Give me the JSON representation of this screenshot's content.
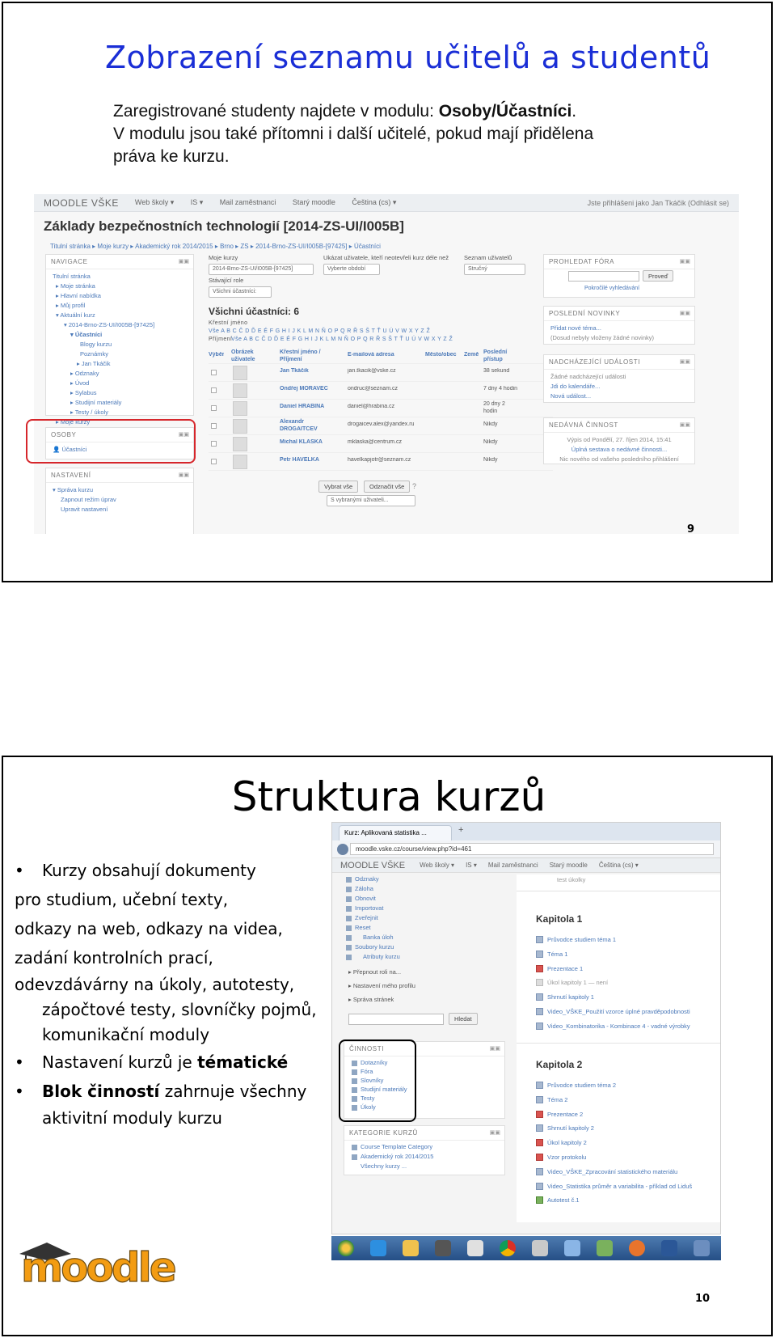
{
  "slide1": {
    "title": "Zobrazení seznamu učitelů a studentů",
    "intro_line1_pre": "Zaregistrované studenty najdete v modulu: ",
    "intro_line1_bold": "Osoby/Účastníci",
    "intro_line1_post": ".",
    "intro_line2": "V modulu jsou také přítomni i další učitelé, pokud mají přidělena",
    "intro_line3": "práva ke kurzu.",
    "page_number": "9",
    "screenshot": {
      "brand": "MOODLE VŠKE",
      "menu": [
        "Web školy ▾",
        "IS ▾",
        "Mail zaměstnanci",
        "Starý moodle",
        "Čeština (cs) ▾"
      ],
      "login": "Jste přihlášeni jako Jan Tkáčik (Odhlásit se)",
      "course_title": "Základy bezpečnostních technologií [2014-ZS-UI/I005B]",
      "breadcrumb": "Titulní stránka  ▸  Moje kurzy  ▸  Akademický rok 2014/2015  ▸  Brno  ▸  ZS  ▸  2014-Brno-ZS-UI/I005B-[97425]  ▸  Účastníci",
      "nav_block": {
        "title": "NAVIGACE",
        "items": [
          "Titulní stránka",
          "▸ Moje stránka",
          "▸ Hlavní nabídka",
          "▸ Můj profil",
          "▾ Aktuální kurz",
          "▾ 2014-Brno-ZS-UI/I005B-[97425]",
          "▾ Účastníci",
          "Blogy kurzu",
          "Poznámky",
          "▸ Jan Tkáčik",
          "▸ Odznaky",
          "▸ Úvod",
          "▸ Sylabus",
          "▸ Studijní materiály",
          "▸ Testy / úkoly",
          "▸ Moje kurzy"
        ]
      },
      "osoby_block": {
        "title": "OSOBY",
        "item": "Účastníci"
      },
      "settings_block": {
        "title": "NASTAVENÍ",
        "items": [
          "▾ Správa kurzu",
          "Zapnout režim úprav",
          "Upravit nastavení"
        ]
      },
      "filters": {
        "my_courses_label": "Moje kurzy",
        "my_courses_value": "2014-Brno-ZS-UI/I005B-[97425]",
        "show_users_label": "Ukázat uživatele, kteří neotevřeli kurz déle než",
        "show_users_value": "Vyberte období",
        "list_label": "Seznam uživatelů",
        "list_value": "Stručný",
        "role_label": "Stávající role",
        "role_value": "Všichni účastníci:"
      },
      "participants_heading": "Všichni účastníci: 6",
      "first_name_label": "Křestní jméno",
      "first_name_letters": "Vše  A B C Č D Ď E É F G H I J K L M N Ň O P Q R Ř S Š T Ť U Ú V W X Y Z Ž",
      "last_name_label": "Příjmení",
      "last_name_letters": "Vše  A B C Č D Ď E É F G H I J K L M N Ň O P Q R Ř S Š T Ť U Ú V W X Y Z Ž",
      "table_headers": [
        "Výběr",
        "Obrázek uživatele",
        "Křestní jméno / Příjmení",
        "E-mailová adresa",
        "Město/obec",
        "Země",
        "Poslední přístup"
      ],
      "rows": [
        {
          "name": "Jan Tkáčik",
          "email": "jan.tkacik@vske.cz",
          "last": "38 sekund"
        },
        {
          "name": "Ondřej MORAVEC",
          "email": "ondruc@seznam.cz",
          "last": "7 dny 4 hodin"
        },
        {
          "name": "Daniel HRABINA",
          "email": "daniel@hrabina.cz",
          "last": "20 dny 2 hodin"
        },
        {
          "name": "Alexandr DROGAITCEV",
          "email": "drogaicev.alex@yandex.ru",
          "last": "Nikdy"
        },
        {
          "name": "Michal KLAŠKA",
          "email": "mklaska@centrum.cz",
          "last": "Nikdy"
        },
        {
          "name": "Petr HAVELKA",
          "email": "havelkapjotr@seznam.cz",
          "last": "Nikdy"
        }
      ],
      "btn_select_all": "Vybrat vše",
      "btn_deselect_all": "Odznačit vše",
      "with_selected": "S vybranými uživateli...",
      "search_block": {
        "title": "PROHLEDAT FÓRA",
        "button": "Proveď",
        "advanced": "Pokročilé vyhledávání"
      },
      "news_block": {
        "title": "POSLEDNÍ NOVINKY",
        "item1": "Přidat nové téma...",
        "item2": "(Dosud nebyly vloženy žádné novinky)"
      },
      "events_block": {
        "title": "NADCHÁZEJÍCÍ UDÁLOSTI",
        "item1": "Žádné nadcházející události",
        "item2": "Jdi do kalendáře...",
        "item3": "Nová událost..."
      },
      "activity_block": {
        "title": "NEDÁVNÁ ČINNOST",
        "item1": "Výpis od Pondělí, 27. říjen 2014, 15:41",
        "item2": "Úplná sestava o nedávné činnosti...",
        "item3": "Nic nového od vašeho posledního přihlášení"
      }
    }
  },
  "slide2": {
    "title": "Struktura kurzů",
    "bullet1_lines": [
      "Kurzy obsahují dokumenty",
      "pro studium, učební texty,",
      "odkazy na web, odkazy na videa,",
      "zadání kontrolních prací,",
      "odevzdávárny na úkoly, autotesty,",
      "zápočtové testy, slovníčky pojmů,",
      "komunikační moduly"
    ],
    "bullet2_pre": "Nastavení kurzů je ",
    "bullet2_bold": "tématické",
    "bullet3_bold": "Blok činností",
    "bullet3_post": " zahrnuje všechny",
    "bullet3_line2": "aktivitní moduly kurzu",
    "page_number": "10",
    "logo_text": "moodle",
    "screenshot": {
      "tab": "Kurz: Aplikovaná statistika ...",
      "url": "moodle.vske.cz/course/view.php?id=461",
      "brand": "MOODLE VŠKE",
      "menu": [
        "Web školy ▾",
        "IS ▾",
        "Mail zaměstnanci",
        "Starý moodle",
        "Čeština (cs) ▾"
      ],
      "admin_items": [
        "Odznaky",
        "Záloha",
        "Obnovit",
        "Importovat",
        "Zveřejnit",
        "Reset",
        "Banka úloh",
        "Soubory kurzu",
        "Atributy kurzu"
      ],
      "admin_other": [
        "▸ Přepnout roli na...",
        "▸ Nastavení mého profilu",
        "▸ Správa stránek"
      ],
      "search_btn": "Hledat",
      "activities_title": "ČINNOSTI",
      "activities": [
        "Dotazníky",
        "Fóra",
        "Slovníky",
        "Studijní materiály",
        "Testy",
        "Úkoly"
      ],
      "categories_title": "KATEGORIE KURZŮ",
      "categories": [
        "Course Template Category",
        "Akademický rok 2014/2015",
        "Všechny kurzy ..."
      ],
      "top_item": "test úkolky",
      "chapter1": "Kapitola 1",
      "chapter1_items": [
        "Průvodce studiem téma 1",
        "Téma 1",
        "Prezentace 1",
        "Úkol kapitoly 1 — není",
        "Shrnutí kapitoly 1",
        "Video_VŠKE_Použití vzorce úplné pravděpodobnosti",
        "Video_Kombinatorika - Kombinace 4 - vadné výrobky"
      ],
      "chapter2": "Kapitola 2",
      "chapter2_items": [
        "Průvodce studiem téma 2",
        "Téma 2",
        "Prezentace 2",
        "Shrnutí kapitoly 2",
        "Úkol kapitoly 2",
        "Vzor protokolu",
        "Video_VŠKE_Zpracování statistického materiálu",
        "Video_Statistika průměr a variabilita - příklad od Liduš",
        "Autotest č.1"
      ]
    }
  }
}
